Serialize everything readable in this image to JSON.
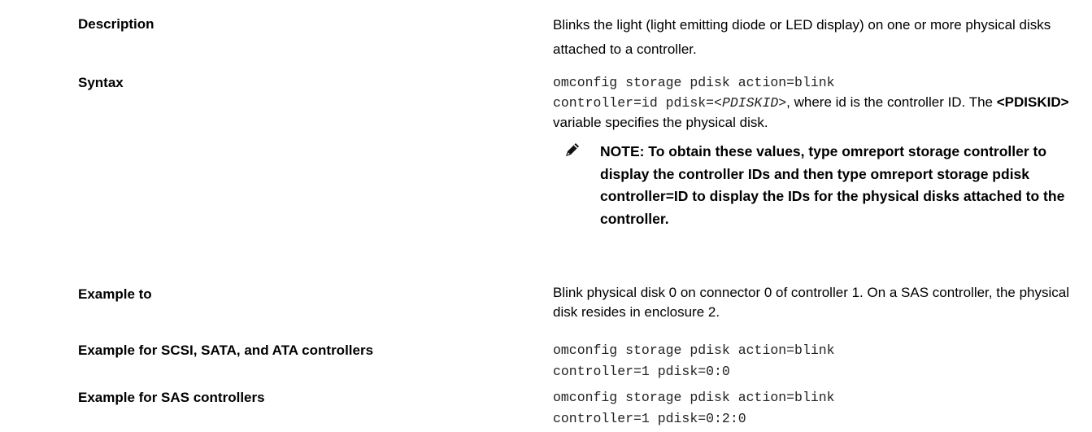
{
  "rows": {
    "description": {
      "label": "Description",
      "text": "Blinks the light (light emitting diode or LED display) on one or more physical disks attached to a controller."
    },
    "syntax": {
      "label": "Syntax",
      "code_line1": "omconfig storage pdisk action=blink",
      "code_line2_prefix": "controller=id pdisk=<",
      "code_var": "PDISKID",
      "code_line2_suffix": ">",
      "text1": ", where id is the controller ID. The ",
      "bold_var": "<PDISKID>",
      "text2": " variable specifies the physical disk.",
      "note_text": "NOTE: To obtain these values, type omreport storage controller to display the controller IDs and then type omreport storage pdisk controller=ID to display the IDs for the physical disks attached to the controller."
    },
    "example_to": {
      "label": "Example to",
      "text": "Blink physical disk 0 on connector 0 of controller 1. On a SAS controller, the physical disk resides in enclosure 2."
    },
    "example_scsi": {
      "label": "Example for SCSI, SATA, and ATA controllers",
      "code_line1": "omconfig storage pdisk action=blink",
      "code_line2": "controller=1 pdisk=0:0"
    },
    "example_sas": {
      "label": "Example for SAS controllers",
      "code_line1": "omconfig storage pdisk action=blink",
      "code_line2": "controller=1 pdisk=0:2:0"
    }
  },
  "note_icon": "pencil-note-icon"
}
